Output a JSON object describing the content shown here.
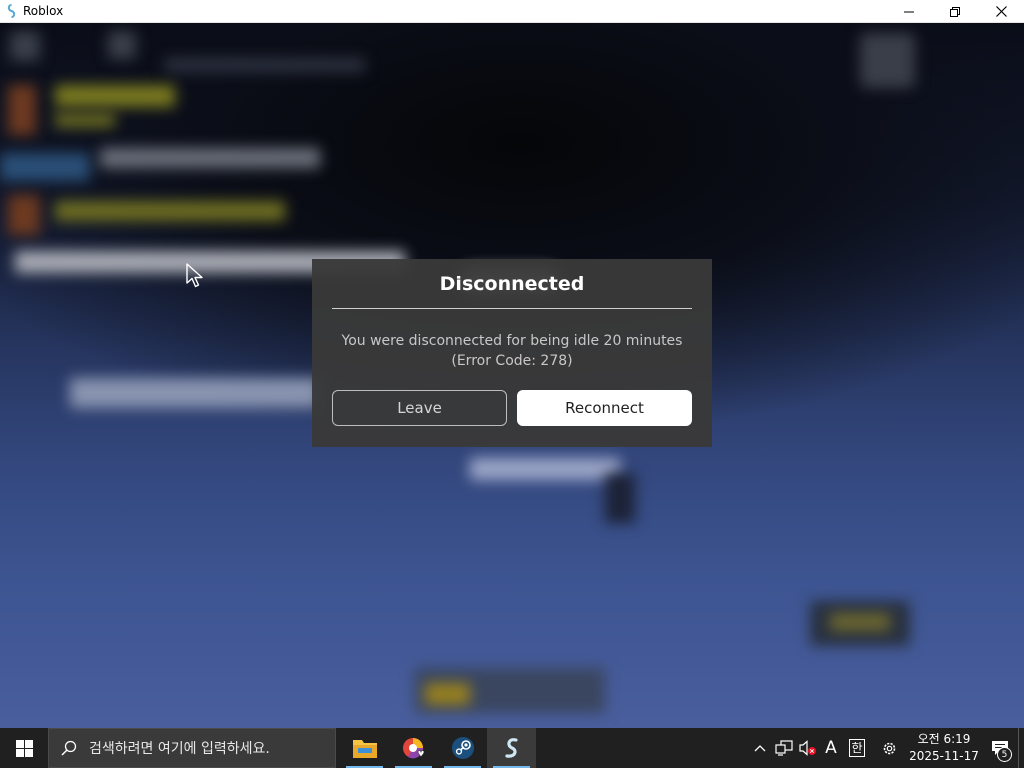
{
  "window": {
    "title": "Roblox",
    "controls": {
      "minimize": "minimize",
      "restore": "restore",
      "close": "close"
    }
  },
  "dialog": {
    "title": "Disconnected",
    "message_line1": "You were disconnected for being idle 20 minutes",
    "message_line2": "(Error Code: 278)",
    "leave_label": "Leave",
    "reconnect_label": "Reconnect"
  },
  "taskbar": {
    "search_placeholder": "검색하려면 여기에 입력하세요.",
    "apps": [
      "file-explorer",
      "browser",
      "steam",
      "roblox"
    ],
    "active_app": "roblox",
    "tray": {
      "ime_mode": "A",
      "ime_lang": "한",
      "clock_time": "오전 6:19",
      "clock_date": "2025-11-17",
      "notification_count": "5"
    }
  },
  "colors": {
    "accent": "#76b9ed",
    "dialog_bg": "#393939",
    "taskbar_bg": "#202020"
  }
}
